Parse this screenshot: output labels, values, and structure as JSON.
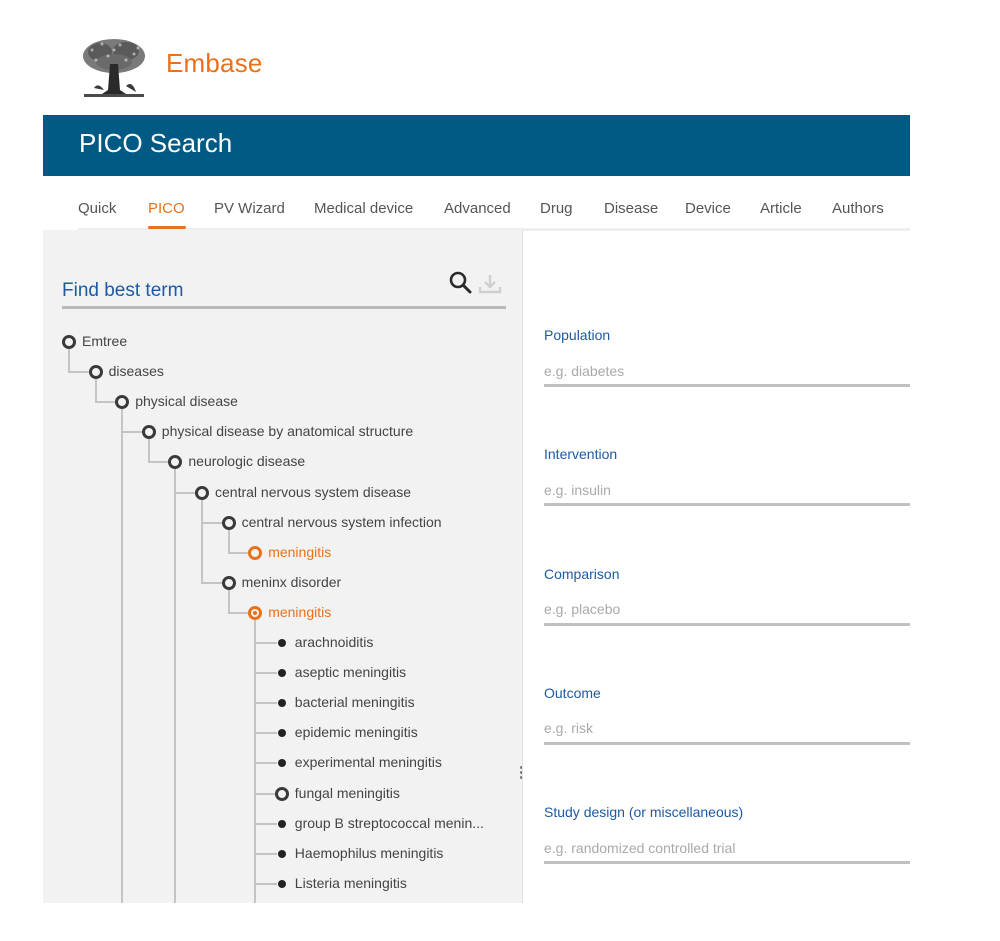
{
  "brand": {
    "name": "Embase",
    "logo_icon": "elsevier-tree-logo"
  },
  "banner": {
    "title": "PICO Search"
  },
  "tabs": [
    {
      "label": "Quick",
      "active": false
    },
    {
      "label": "PICO",
      "active": true
    },
    {
      "label": "PV Wizard",
      "active": false
    },
    {
      "label": "Medical device",
      "active": false
    },
    {
      "label": "Advanced",
      "active": false
    },
    {
      "label": "Drug",
      "active": false
    },
    {
      "label": "Disease",
      "active": false
    },
    {
      "label": "Device",
      "active": false
    },
    {
      "label": "Article",
      "active": false
    },
    {
      "label": "Authors",
      "active": false
    }
  ],
  "find_best_term": {
    "title": "Find best term",
    "search_icon": "search-icon",
    "download_icon": "download-icon",
    "download_enabled": false
  },
  "tree": [
    {
      "label": "Emtree",
      "level": 0,
      "node": "open",
      "highlight": false
    },
    {
      "label": "diseases",
      "level": 1,
      "node": "open",
      "highlight": false
    },
    {
      "label": "physical disease",
      "level": 2,
      "node": "open",
      "highlight": false
    },
    {
      "label": "physical disease by anatomical structure",
      "level": 3,
      "node": "open",
      "highlight": false
    },
    {
      "label": "neurologic disease",
      "level": 4,
      "node": "open",
      "highlight": false
    },
    {
      "label": "central nervous system disease",
      "level": 5,
      "node": "open",
      "highlight": false
    },
    {
      "label": "central nervous system infection",
      "level": 6,
      "node": "open",
      "highlight": false
    },
    {
      "label": "meningitis",
      "level": 7,
      "node": "open",
      "highlight": true,
      "selected": false
    },
    {
      "label": "meninx disorder",
      "level": 6,
      "node": "open",
      "highlight": false
    },
    {
      "label": "meningitis",
      "level": 7,
      "node": "open",
      "highlight": true,
      "selected": true
    },
    {
      "label": "arachnoiditis",
      "level": 8,
      "node": "leaf",
      "highlight": false
    },
    {
      "label": "aseptic meningitis",
      "level": 8,
      "node": "leaf",
      "highlight": false
    },
    {
      "label": "bacterial meningitis",
      "level": 8,
      "node": "leaf",
      "highlight": false
    },
    {
      "label": "epidemic meningitis",
      "level": 8,
      "node": "leaf",
      "highlight": false
    },
    {
      "label": "experimental meningitis",
      "level": 8,
      "node": "leaf",
      "highlight": false
    },
    {
      "label": "fungal meningitis",
      "level": 8,
      "node": "open",
      "highlight": false
    },
    {
      "label": "group B streptococcal menin...",
      "level": 8,
      "node": "leaf",
      "highlight": false
    },
    {
      "label": "Haemophilus meningitis",
      "level": 8,
      "node": "leaf",
      "highlight": false
    },
    {
      "label": "Listeria meningitis",
      "level": 8,
      "node": "leaf",
      "highlight": false
    }
  ],
  "pico_fields": [
    {
      "label": "Population",
      "placeholder": "e.g. diabetes",
      "value": ""
    },
    {
      "label": "Intervention",
      "placeholder": "e.g. insulin",
      "value": ""
    },
    {
      "label": "Comparison",
      "placeholder": "e.g. placebo",
      "value": ""
    },
    {
      "label": "Outcome",
      "placeholder": "e.g. risk",
      "value": ""
    },
    {
      "label": "Study design (or miscellaneous)",
      "placeholder": "e.g. randomized controlled trial",
      "value": ""
    }
  ],
  "colors": {
    "brand_orange": "#e9711c",
    "banner_blue": "#005a83",
    "label_blue": "#1c5aa6",
    "panel_gray": "#f2f2f2"
  }
}
